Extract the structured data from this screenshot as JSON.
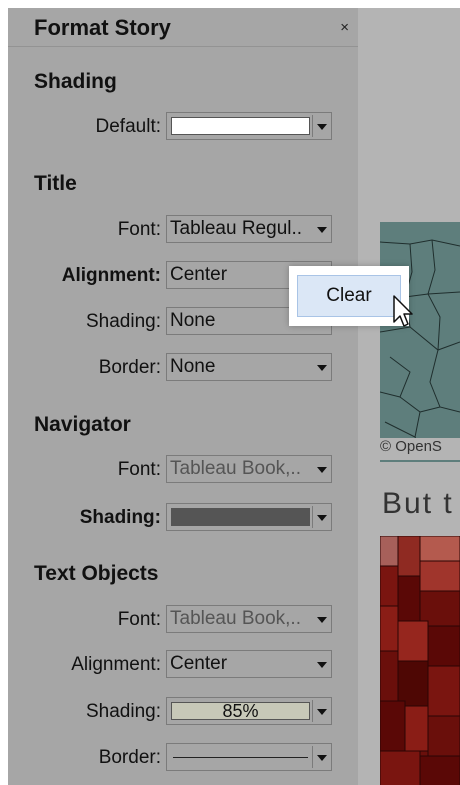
{
  "panel": {
    "title": "Format Story",
    "close": "×",
    "shading": {
      "section": "Shading",
      "default_label": "Default:",
      "default_color": "#ffffff"
    },
    "title_section": {
      "section": "Title",
      "font_label": "Font:",
      "font_value": "Tableau Regul..",
      "alignment_label": "Alignment:",
      "alignment_value": "Center",
      "shading_label": "Shading:",
      "shading_value": "None",
      "border_label": "Border:",
      "border_value": "None"
    },
    "navigator": {
      "section": "Navigator",
      "font_label": "Font:",
      "font_value": "Tableau Book,..",
      "shading_label": "Shading:",
      "shading_color": "#555555"
    },
    "text_objects": {
      "section": "Text Objects",
      "font_label": "Font:",
      "font_value": "Tableau Book,..",
      "alignment_label": "Alignment:",
      "alignment_value": "Center",
      "shading_label": "Shading:",
      "shading_value": "85%",
      "shading_color": "#c7c8b8",
      "border_label": "Border:"
    }
  },
  "context_menu": {
    "clear_label": "Clear"
  },
  "canvas": {
    "map_credit": "© OpenS",
    "story_text": "But t",
    "map1_color": "#5e7e7c",
    "map2_color": "#6a0f0b"
  }
}
